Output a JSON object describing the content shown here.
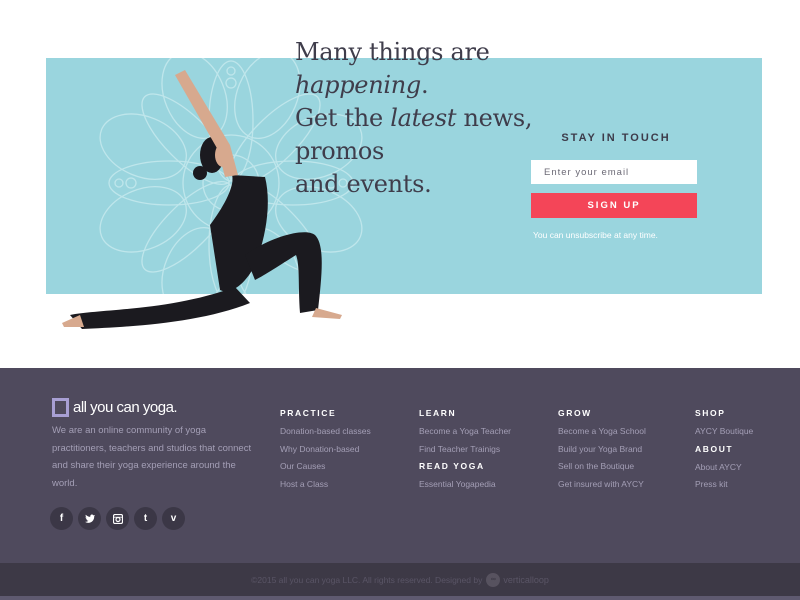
{
  "hero": {
    "headline": {
      "line1_pre": "Many things are ",
      "line1_em": "happening",
      "line1_post": ".",
      "line2_pre": "Get the ",
      "line2_em": "latest",
      "line2_post": " news, promos",
      "line3": "and events."
    },
    "colors": {
      "band": "#9ad5de",
      "accent": "#f44558"
    }
  },
  "signup": {
    "title": "STAY IN TOUCH",
    "email_placeholder": "Enter your email",
    "email_value": "",
    "button_label": "SIGN UP",
    "note": "You can unsubscribe at any time."
  },
  "footer": {
    "logo_text": "all you can yoga.",
    "about": "We are an online community of yoga practitioners, teachers and studios that connect and share their yoga experience around the world.",
    "socials": [
      {
        "icon": "facebook-icon",
        "glyph": "f"
      },
      {
        "icon": "twitter-icon",
        "glyph": "🐦"
      },
      {
        "icon": "instagram-icon",
        "glyph": "◙"
      },
      {
        "icon": "tumblr-icon",
        "glyph": "t"
      },
      {
        "icon": "vimeo-icon",
        "glyph": "v"
      }
    ],
    "columns": {
      "practice": {
        "heading": "PRACTICE",
        "links": [
          "Donation-based classes",
          "Why Donation-based",
          "Our Causes",
          "Host a Class"
        ]
      },
      "learn": {
        "heading": "LEARN",
        "links": [
          "Become a Yoga Teacher",
          "Find Teacher Trainigs"
        ]
      },
      "read_yoga": {
        "heading": "READ YOGA",
        "links": [
          "Essential Yogapedia"
        ]
      },
      "grow": {
        "heading": "GROW",
        "links": [
          "Become a Yoga School",
          "Build your Yoga Brand",
          "Sell on the Boutique",
          "Get insured with AYCY"
        ]
      },
      "shop": {
        "heading": "SHOP",
        "links": [
          "AYCY Boutique"
        ]
      },
      "about": {
        "heading": "ABOUT",
        "links": [
          "About AYCY",
          "Press kit"
        ]
      }
    },
    "copyright": "©2015 all you can yoga LLC. All rights reserved. Designed by",
    "designer": "verticalloop"
  }
}
